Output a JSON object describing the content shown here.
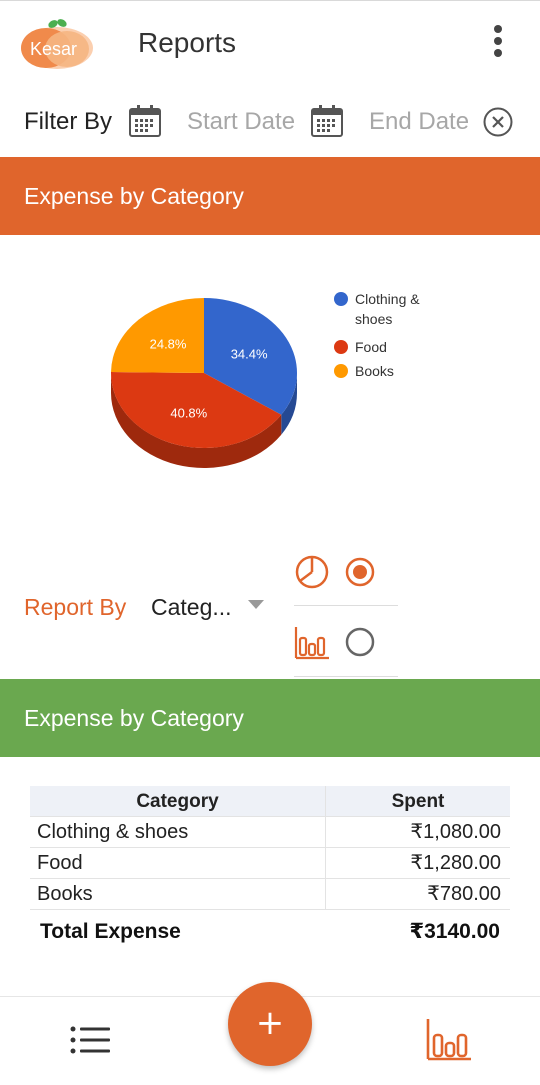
{
  "app": {
    "logo_text": "Kesar",
    "title": "Reports"
  },
  "filter": {
    "label": "Filter By",
    "start_placeholder": "Start Date",
    "end_placeholder": "End Date"
  },
  "sections": {
    "chart_title": "Expense by Category",
    "table_title": "Expense by Category"
  },
  "report_by": {
    "label": "Report By",
    "selected": "Categ..."
  },
  "chart_options": {
    "pie_selected": true,
    "bar_selected": false
  },
  "chart_data": {
    "type": "pie",
    "slices": [
      {
        "label": "Clothing & shoes",
        "legend_lines": [
          "Clothing &",
          "shoes"
        ],
        "value": 34.4,
        "display": "34.4%",
        "color": "#3366cc"
      },
      {
        "label": "Food",
        "legend_lines": [
          "Food"
        ],
        "value": 40.8,
        "display": "40.8%",
        "color": "#dc3912"
      },
      {
        "label": "Books",
        "legend_lines": [
          "Books"
        ],
        "value": 24.8,
        "display": "24.8%",
        "color": "#ff9900"
      }
    ],
    "legend_position": "right"
  },
  "table": {
    "headers": [
      "Category",
      "Spent"
    ],
    "rows": [
      {
        "category": "Clothing & shoes",
        "spent": "₹1,080.00"
      },
      {
        "category": "Food",
        "spent": "₹1,280.00"
      },
      {
        "category": "Books",
        "spent": "₹780.00"
      }
    ],
    "total_label": "Total Expense",
    "total_value": "₹3140.00"
  },
  "fab": {
    "symbol": "+"
  },
  "colors": {
    "accent": "#e0652c",
    "green": "#6aa84f"
  }
}
